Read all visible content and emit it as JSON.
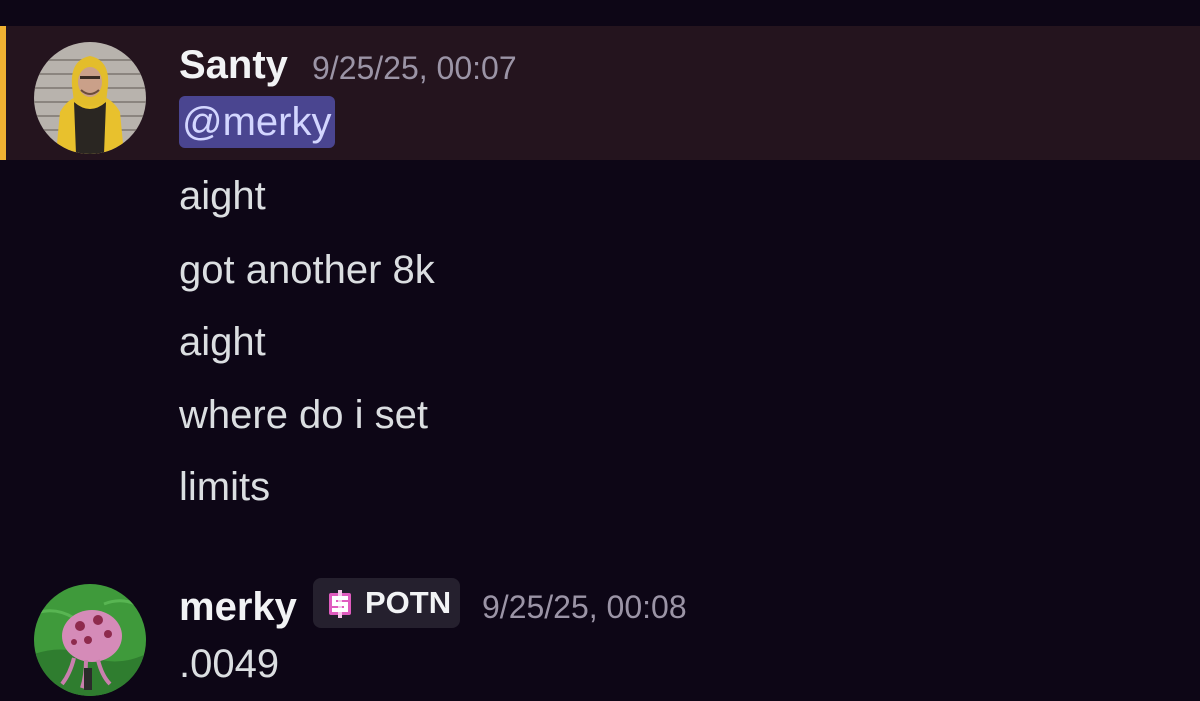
{
  "messages": [
    {
      "author": "Santy",
      "timestamp": "9/25/25, 00:07",
      "mention": "@merky",
      "lines": [
        "aight",
        "got another 8k",
        "aight",
        "where do i set",
        "limits"
      ]
    },
    {
      "author": "merky",
      "tag": "POTN",
      "timestamp": "9/25/25, 00:08",
      "lines": [
        ".0049"
      ]
    }
  ],
  "colors": {
    "background": "#0d0616",
    "highlight": "#24141e",
    "highlight_bar": "#f0b232",
    "mention_bg": "#4a4590",
    "tag_bg": "#25202e"
  },
  "icons": {
    "tag_icon": "pink-dollar-pixel-icon"
  }
}
